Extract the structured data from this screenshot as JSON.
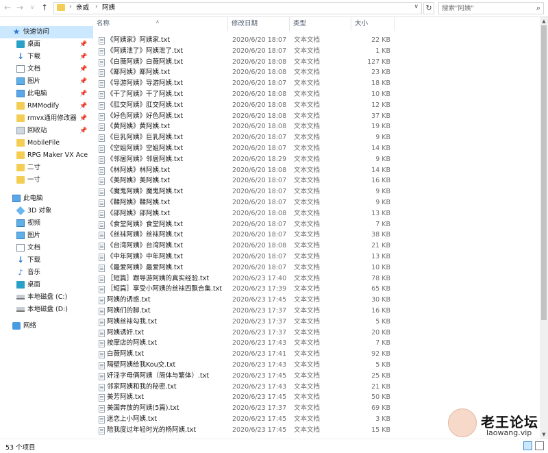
{
  "address": {
    "crumbs": [
      "亲威",
      "阿姨"
    ],
    "search_placeholder": "搜索\"阿姨\""
  },
  "sidebar": {
    "quick_access": "快速访问",
    "quick_items": [
      "桌面",
      "下载",
      "文档",
      "图片",
      "此电脑",
      "RMModify",
      "rmvx通用修改器",
      "回收站",
      "MobileFile",
      "RPG Maker VX Ace",
      "二寸",
      "一寸"
    ],
    "this_pc": "此电脑",
    "pc_items": [
      "3D 对象",
      "视频",
      "图片",
      "文档",
      "下载",
      "音乐",
      "桌面",
      "本地磁盘 (C:)",
      "本地磁盘 (D:)"
    ],
    "network": "网络"
  },
  "columns": {
    "name": "名称",
    "date": "修改日期",
    "type": "类型",
    "size": "大小"
  },
  "files": [
    {
      "name": "《阿姨家》阿姨家.txt",
      "date": "2020/6/20 18:07",
      "type": "文本文档",
      "size": "22 KB"
    },
    {
      "name": "《阿姨泄了》阿姨泄了.txt",
      "date": "2020/6/20 18:07",
      "type": "文本文档",
      "size": "1 KB"
    },
    {
      "name": "《白薇阿姨》白薇阿姨.txt",
      "date": "2020/6/20 18:08",
      "type": "文本文档",
      "size": "127 KB"
    },
    {
      "name": "《鄙阿姨》鄙阿姨.txt",
      "date": "2020/6/20 18:08",
      "type": "文本文档",
      "size": "23 KB"
    },
    {
      "name": "《导游阿姨》导游阿姨.txt",
      "date": "2020/6/20 18:07",
      "type": "文本文档",
      "size": "18 KB"
    },
    {
      "name": "《干了阿姨》干了阿姨.txt",
      "date": "2020/6/20 18:08",
      "type": "文本文档",
      "size": "10 KB"
    },
    {
      "name": "《肛交阿姨》肛交阿姨.txt",
      "date": "2020/6/20 18:08",
      "type": "文本文档",
      "size": "12 KB"
    },
    {
      "name": "《好色阿姨》好色阿姨.txt",
      "date": "2020/6/20 18:08",
      "type": "文本文档",
      "size": "37 KB"
    },
    {
      "name": "《黄阿姨》黄阿姨.txt",
      "date": "2020/6/20 18:08",
      "type": "文本文档",
      "size": "19 KB"
    },
    {
      "name": "《巨乳阿姨》巨乳阿姨.txt",
      "date": "2020/6/20 18:07",
      "type": "文本文档",
      "size": "9 KB"
    },
    {
      "name": "《空姐阿姨》空姐阿姨.txt",
      "date": "2020/6/20 18:07",
      "type": "文本文档",
      "size": "14 KB"
    },
    {
      "name": "《邻居阿姨》邻居阿姨.txt",
      "date": "2020/6/20 18:29",
      "type": "文本文档",
      "size": "9 KB"
    },
    {
      "name": "《林阿姨》林阿姨.txt",
      "date": "2020/6/20 18:08",
      "type": "文本文档",
      "size": "14 KB"
    },
    {
      "name": "《美阿姨》美阿姨.txt",
      "date": "2020/6/20 18:07",
      "type": "文本文档",
      "size": "16 KB"
    },
    {
      "name": "《魔鬼阿姨》魔鬼阿姨.txt",
      "date": "2020/6/20 18:07",
      "type": "文本文档",
      "size": "9 KB"
    },
    {
      "name": "《鞣阿姨》鞣阿姨.txt",
      "date": "2020/6/20 18:07",
      "type": "文本文档",
      "size": "9 KB"
    },
    {
      "name": "《邵阿姨》邵阿姨.txt",
      "date": "2020/6/20 18:08",
      "type": "文本文档",
      "size": "13 KB"
    },
    {
      "name": "《食堂阿姨》食堂阿姨.txt",
      "date": "2020/6/20 18:07",
      "type": "文本文档",
      "size": "7 KB"
    },
    {
      "name": "《丝袜阿姨》丝袜阿姨.txt",
      "date": "2020/6/20 18:07",
      "type": "文本文档",
      "size": "38 KB"
    },
    {
      "name": "《台湾阿姨》台湾阿姨.txt",
      "date": "2020/6/20 18:08",
      "type": "文本文档",
      "size": "21 KB"
    },
    {
      "name": "《中年阿姨》中年阿姨.txt",
      "date": "2020/6/20 18:07",
      "type": "文本文档",
      "size": "13 KB"
    },
    {
      "name": "《最爱阿姨》最爱阿姨.txt",
      "date": "2020/6/20 18:07",
      "type": "文本文档",
      "size": "10 KB"
    },
    {
      "name": "［短篇］跟导游阿姨的真实经验.txt",
      "date": "2020/6/23 17:40",
      "type": "文本文档",
      "size": "78 KB"
    },
    {
      "name": "［短篇］享受小阿姨的丝袜四飘合集.txt",
      "date": "2020/6/23 17:39",
      "type": "文本文档",
      "size": "65 KB"
    },
    {
      "name": "阿姨的诱惑.txt",
      "date": "2020/6/23 17:45",
      "type": "文本文档",
      "size": "30 KB"
    },
    {
      "name": "阿姨们的脚.txt",
      "date": "2020/6/23 17:37",
      "type": "文本文档",
      "size": "16 KB"
    },
    {
      "name": "阿姨丝袜勾我.txt",
      "date": "2020/6/23 17:37",
      "type": "文本文档",
      "size": "5 KB"
    },
    {
      "name": "阿姨诱奸.txt",
      "date": "2020/6/23 17:37",
      "type": "文本文档",
      "size": "20 KB"
    },
    {
      "name": "按摩店的阿姨.txt",
      "date": "2020/6/23 17:43",
      "type": "文本文档",
      "size": "7 KB"
    },
    {
      "name": "白薇阿姨.txt",
      "date": "2020/6/23 17:41",
      "type": "文本文档",
      "size": "92 KB"
    },
    {
      "name": "隔壁阿姨给我Kou交.txt",
      "date": "2020/6/23 17:43",
      "type": "文本文档",
      "size": "5 KB"
    },
    {
      "name": "奸淫字母俩阿姨（简体与繁体）.txt",
      "date": "2020/6/23 17:45",
      "type": "文本文档",
      "size": "25 KB"
    },
    {
      "name": "邻家阿姨和我的秘密.txt",
      "date": "2020/6/23 17:43",
      "type": "文本文档",
      "size": "21 KB"
    },
    {
      "name": "美芳阿姨.txt",
      "date": "2020/6/23 17:45",
      "type": "文本文档",
      "size": "50 KB"
    },
    {
      "name": "美国奔放的阿姨(5篇).txt",
      "date": "2020/6/23 17:37",
      "type": "文本文档",
      "size": "69 KB"
    },
    {
      "name": "迷恋上小阿姨.txt",
      "date": "2020/6/23 17:45",
      "type": "文本文档",
      "size": "3 KB"
    },
    {
      "name": "陪我度过年轻时光的杨阿姨.txt",
      "date": "2020/6/23 17:45",
      "type": "文本文档",
      "size": "15 KB"
    }
  ],
  "status": {
    "count": "53 个项目"
  },
  "watermark": {
    "title": "老王论坛",
    "url": "laowang.vip"
  },
  "colors": {
    "selection": "#cce8ff",
    "folder": "#f4cd55",
    "accent": "#2b79d8"
  }
}
